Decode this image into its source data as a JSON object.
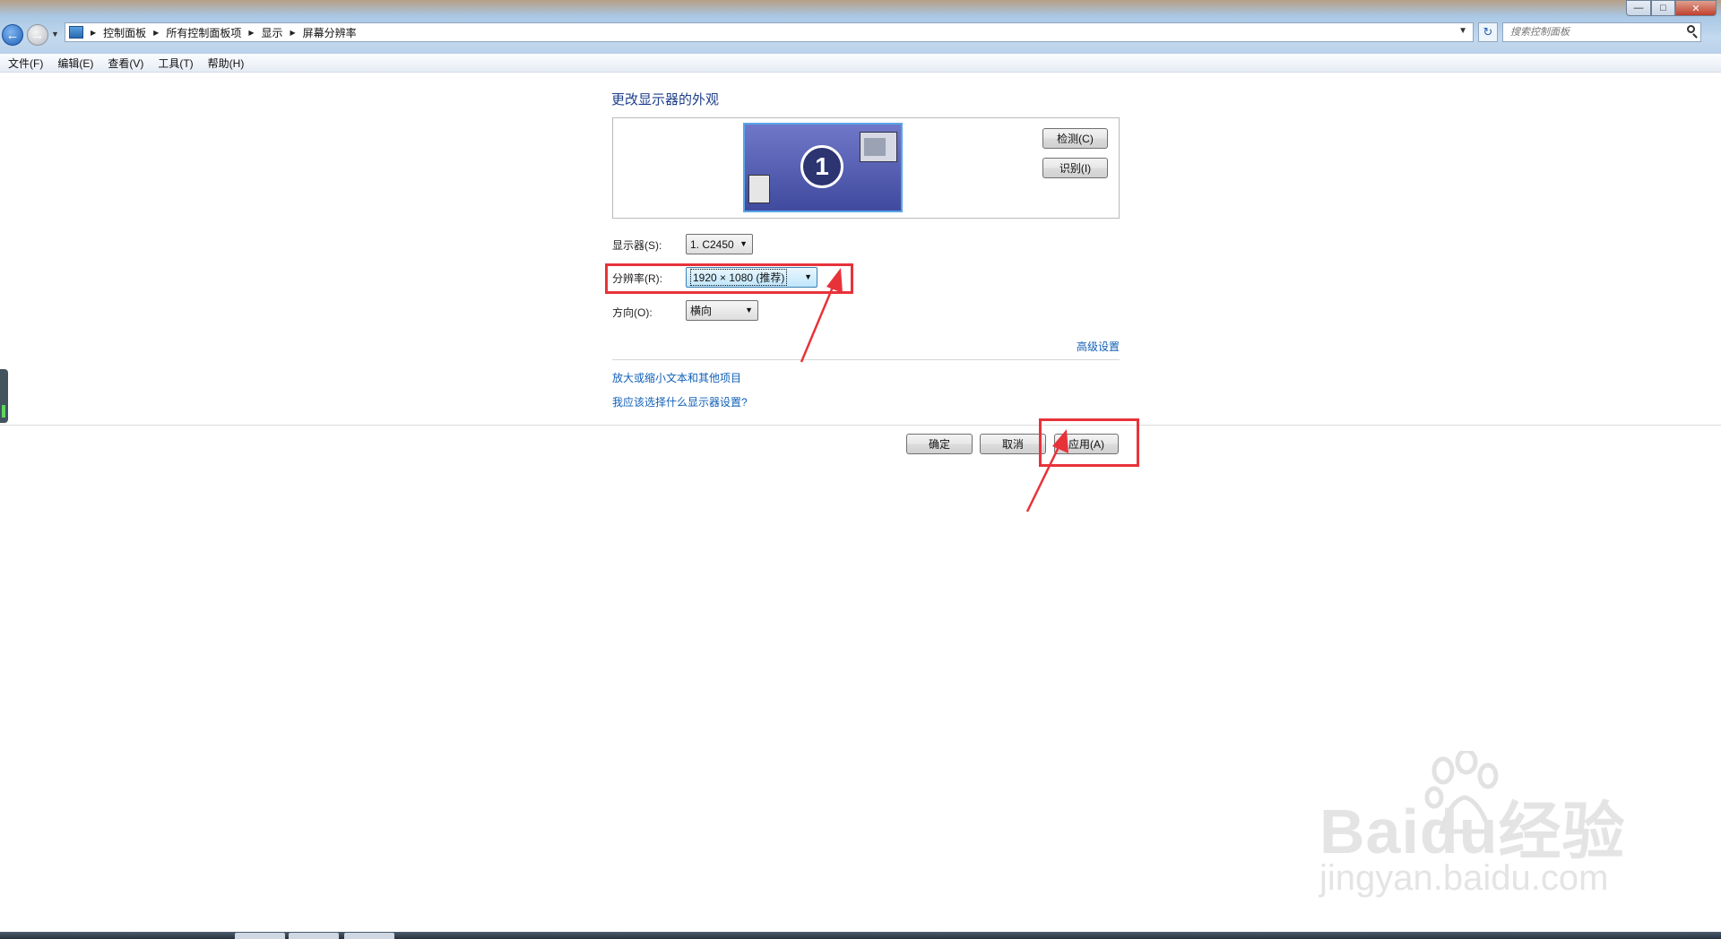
{
  "breadcrumb": [
    "控制面板",
    "所有控制面板项",
    "显示",
    "屏幕分辨率"
  ],
  "search": {
    "placeholder": "搜索控制面板"
  },
  "menu": [
    "文件(F)",
    "编辑(E)",
    "查看(V)",
    "工具(T)",
    "帮助(H)"
  ],
  "page": {
    "title": "更改显示器的外观",
    "monitor_number": "1",
    "detect_button": "检测(C)",
    "identify_button": "识别(I)",
    "display_label": "显示器(S):",
    "display_value": "1. C2450",
    "resolution_label": "分辨率(R):",
    "resolution_value": "1920 × 1080 (推荐)",
    "orientation_label": "方向(O):",
    "orientation_value": "横向",
    "advanced_link": "高级设置",
    "link_text_size": "放大或缩小文本和其他项目",
    "link_help": "我应该选择什么显示器设置?"
  },
  "buttons": {
    "ok": "确定",
    "cancel": "取消",
    "apply": "应用(A)"
  },
  "watermark": {
    "logo": "Baidu经验",
    "url": "jingyan.baidu.com"
  },
  "colors": {
    "annotation": "#e8323a",
    "link": "#1160b8",
    "title": "#1e3f8a"
  }
}
